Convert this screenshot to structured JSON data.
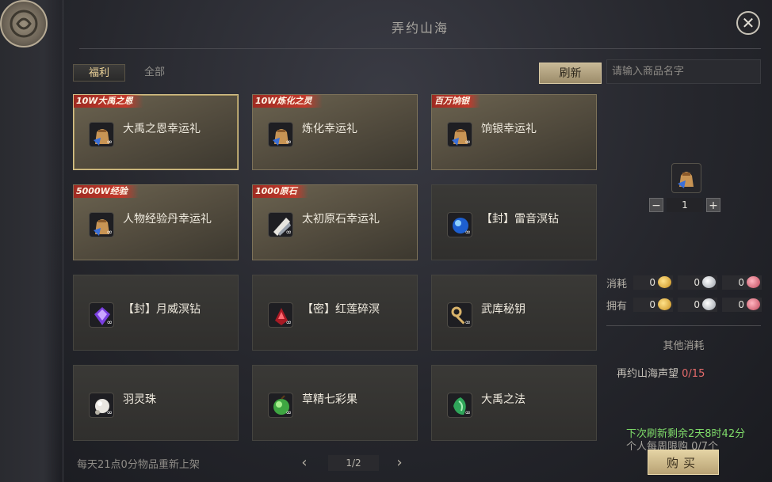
{
  "window": {
    "title": "弄约山海"
  },
  "tabs": [
    {
      "label": "福利",
      "active": true
    },
    {
      "label": "全部",
      "active": false
    }
  ],
  "toolbar": {
    "refresh_label": "刷新"
  },
  "search": {
    "placeholder": "请输入商品名字"
  },
  "items": [
    {
      "name": "大禹之恩幸运礼",
      "ribbon": "10W大禹之恩",
      "icon": "gift-bag-icon",
      "featured": true,
      "selected": true
    },
    {
      "name": "炼化幸运礼",
      "ribbon": "10W炼化之灵",
      "icon": "gift-bag-icon",
      "featured": true
    },
    {
      "name": "饷银幸运礼",
      "ribbon": "百万饷银",
      "icon": "gift-bag-icon",
      "featured": true
    },
    {
      "name": "人物经验丹幸运礼",
      "ribbon": "5000W经验",
      "icon": "gift-bag-icon",
      "featured": true
    },
    {
      "name": "太初原石幸运礼",
      "ribbon": "1000原石",
      "icon": "crystal-icon",
      "featured": true
    },
    {
      "name": "【封】雷音溟钻",
      "ribbon": "",
      "icon": "blue-gem-icon",
      "featured": false
    },
    {
      "name": "【封】月威溟钻",
      "ribbon": "",
      "icon": "purple-gem-icon",
      "featured": false
    },
    {
      "name": "【密】红莲碎溟",
      "ribbon": "",
      "icon": "red-shard-icon",
      "featured": false
    },
    {
      "name": "武库秘钥",
      "ribbon": "",
      "icon": "key-icon",
      "featured": false
    },
    {
      "name": "羽灵珠",
      "ribbon": "",
      "icon": "pearl-icon",
      "featured": false
    },
    {
      "name": "草精七彩果",
      "ribbon": "",
      "icon": "green-fruit-icon",
      "featured": false
    },
    {
      "name": "大禹之法",
      "ribbon": "",
      "icon": "jade-icon",
      "featured": false
    }
  ],
  "item_badge": "∞",
  "detail": {
    "quantity": "1",
    "minus_label": "−",
    "plus_label": "+",
    "cost_label": "消耗",
    "own_label": "拥有",
    "cost_values": [
      "0",
      "0",
      "0"
    ],
    "own_values": [
      "0",
      "0",
      "0"
    ],
    "currency_icons": [
      "gold-coin-icon",
      "silver-coin-icon",
      "pink-coin-icon"
    ],
    "other_cost_label": "其他消耗",
    "prestige_label": "再约山海声望",
    "prestige_value": "0/15"
  },
  "refresh_timer": "下次刷新剩余2天8时42分",
  "weekly_limit": "个人每周限购  0/7个",
  "buy_label": "购买",
  "footer_note": "每天21点0分物品重新上架",
  "pager": {
    "prev": "‹",
    "next": "›",
    "value": "1/2"
  },
  "colors": {
    "accent_gold": "#d8c48a",
    "ribbon_red": "#c23a2c",
    "timer_green": "#7fdc6a",
    "prestige_red": "#e56b6b"
  }
}
